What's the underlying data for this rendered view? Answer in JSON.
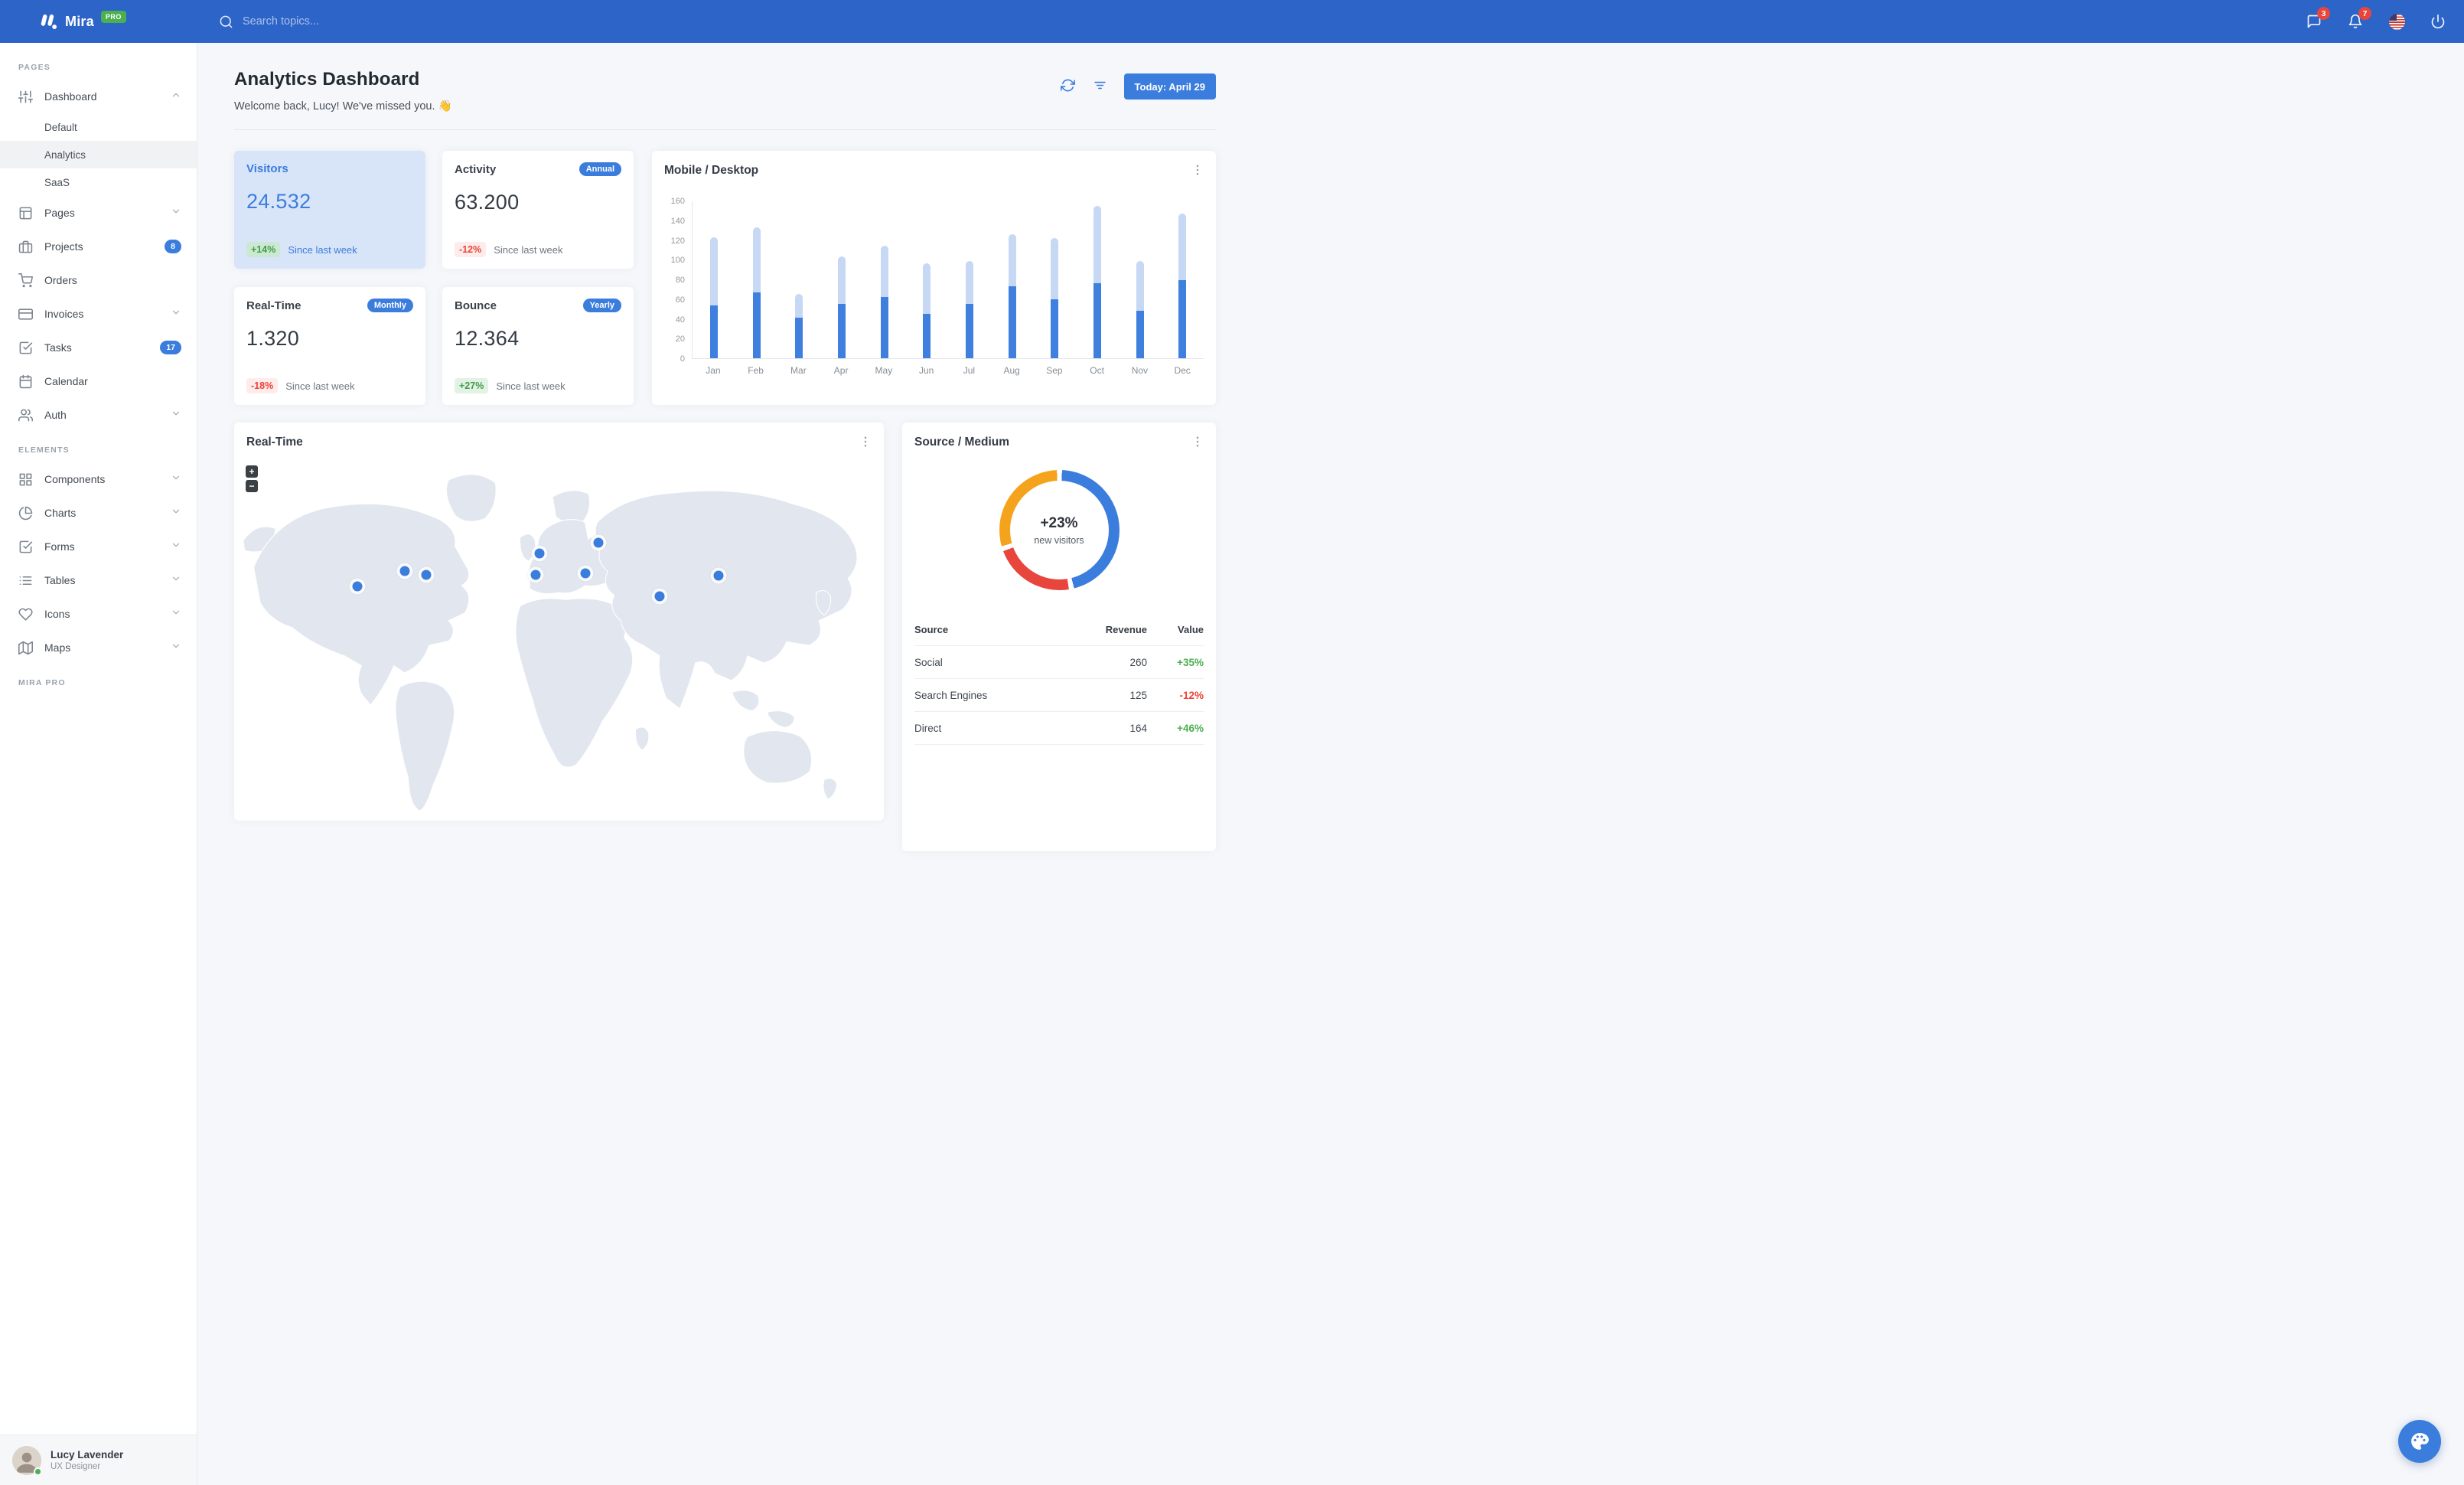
{
  "navbar": {
    "app_name": "Mira",
    "plan_badge": "PRO",
    "search_placeholder": "Search topics...",
    "messages_badge": "3",
    "notifications_badge": "7"
  },
  "sidebar": {
    "sections": [
      {
        "label": "PAGES",
        "items": [
          {
            "label": "Dashboard",
            "icon": "sliders",
            "chevron": "up",
            "children": [
              {
                "label": "Default"
              },
              {
                "label": "Analytics",
                "active": true
              },
              {
                "label": "SaaS"
              }
            ]
          },
          {
            "label": "Pages",
            "icon": "layout",
            "chevron": "down"
          },
          {
            "label": "Projects",
            "icon": "briefcase",
            "badge": "8"
          },
          {
            "label": "Orders",
            "icon": "shopping-cart"
          },
          {
            "label": "Invoices",
            "icon": "credit-card",
            "chevron": "down"
          },
          {
            "label": "Tasks",
            "icon": "check-square",
            "badge": "17"
          },
          {
            "label": "Calendar",
            "icon": "calendar"
          },
          {
            "label": "Auth",
            "icon": "users",
            "chevron": "down"
          }
        ]
      },
      {
        "label": "ELEMENTS",
        "items": [
          {
            "label": "Components",
            "icon": "grid",
            "chevron": "down"
          },
          {
            "label": "Charts",
            "icon": "pie-chart",
            "chevron": "down"
          },
          {
            "label": "Forms",
            "icon": "check-square",
            "chevron": "down"
          },
          {
            "label": "Tables",
            "icon": "list",
            "chevron": "down"
          },
          {
            "label": "Icons",
            "icon": "heart",
            "chevron": "down"
          },
          {
            "label": "Maps",
            "icon": "map",
            "chevron": "down"
          }
        ]
      },
      {
        "label": "MIRA PRO",
        "items": []
      }
    ],
    "user": {
      "name": "Lucy Lavender",
      "role": "UX Designer",
      "status": "online"
    }
  },
  "header": {
    "title": "Analytics Dashboard",
    "subtitle": "Welcome back, Lucy! We've missed you. 👋",
    "date_button": "Today: April 29"
  },
  "stats": [
    {
      "title": "Visitors",
      "value": "24.532",
      "delta": "+14%",
      "direction": "up",
      "note": "Since last week",
      "variant": "primary"
    },
    {
      "title": "Activity",
      "badge": "Annual",
      "value": "63.200",
      "delta": "-12%",
      "direction": "down",
      "note": "Since last week"
    },
    {
      "title": "Real-Time",
      "badge": "Monthly",
      "value": "1.320",
      "delta": "-18%",
      "direction": "down",
      "note": "Since last week"
    },
    {
      "title": "Bounce",
      "badge": "Yearly",
      "value": "12.364",
      "delta": "+27%",
      "direction": "up",
      "note": "Since last week"
    }
  ],
  "chart_data": [
    {
      "type": "bar",
      "title": "Mobile / Desktop",
      "stacked": true,
      "categories": [
        "Jan",
        "Feb",
        "Mar",
        "Apr",
        "May",
        "Jun",
        "Jul",
        "Aug",
        "Sep",
        "Oct",
        "Nov",
        "Dec"
      ],
      "series": [
        {
          "name": "Mobile",
          "color": "#3f80de",
          "values": [
            54,
            67,
            41,
            55,
            62,
            45,
            55,
            73,
            60,
            76,
            48,
            79
          ]
        },
        {
          "name": "Desktop",
          "color": "#c6d8f3",
          "values": [
            69,
            66,
            24,
            48,
            52,
            51,
            44,
            53,
            62,
            79,
            51,
            68
          ]
        }
      ],
      "ylabel": "",
      "xlabel": "",
      "ylim": [
        0,
        160
      ],
      "ytick_step": 20,
      "grid": false,
      "legend": "none"
    },
    {
      "type": "pie",
      "title": "Source / Medium",
      "donut": true,
      "labels": [
        "Social",
        "Search Engines",
        "Direct"
      ],
      "values": [
        260,
        125,
        164
      ],
      "colors": [
        "#3B7DDD",
        "#E8453C",
        "#F5A31C"
      ],
      "center_title": "+23%",
      "center_subtitle": "new visitors"
    }
  ],
  "map_card": {
    "title": "Real-Time",
    "zoom_in": "+",
    "zoom_out": "−",
    "markers": [
      {
        "x": 19.0,
        "y": 36.0
      },
      {
        "x": 26.3,
        "y": 31.9
      },
      {
        "x": 29.6,
        "y": 32.9
      },
      {
        "x": 47.0,
        "y": 26.9
      },
      {
        "x": 46.4,
        "y": 32.9
      },
      {
        "x": 56.1,
        "y": 24.0
      },
      {
        "x": 54.1,
        "y": 32.4
      },
      {
        "x": 65.5,
        "y": 38.6
      },
      {
        "x": 74.6,
        "y": 33.1
      }
    ]
  },
  "source_medium": {
    "title": "Source / Medium",
    "center_value": "+23%",
    "center_label": "new visitors",
    "headers": [
      "Source",
      "Revenue",
      "Value"
    ],
    "rows": [
      {
        "source": "Social",
        "revenue": "260",
        "value": "+35%"
      },
      {
        "source": "Search Engines",
        "revenue": "125",
        "value": "-12%"
      },
      {
        "source": "Direct",
        "revenue": "164",
        "value": "+46%"
      }
    ]
  },
  "colors": {
    "primary": "#3B7DDD",
    "navbar": "#2d64c8",
    "success": "#4CAF50",
    "danger": "#E8453C",
    "warning": "#F5A31C",
    "page_bg": "#f5f7fb"
  }
}
